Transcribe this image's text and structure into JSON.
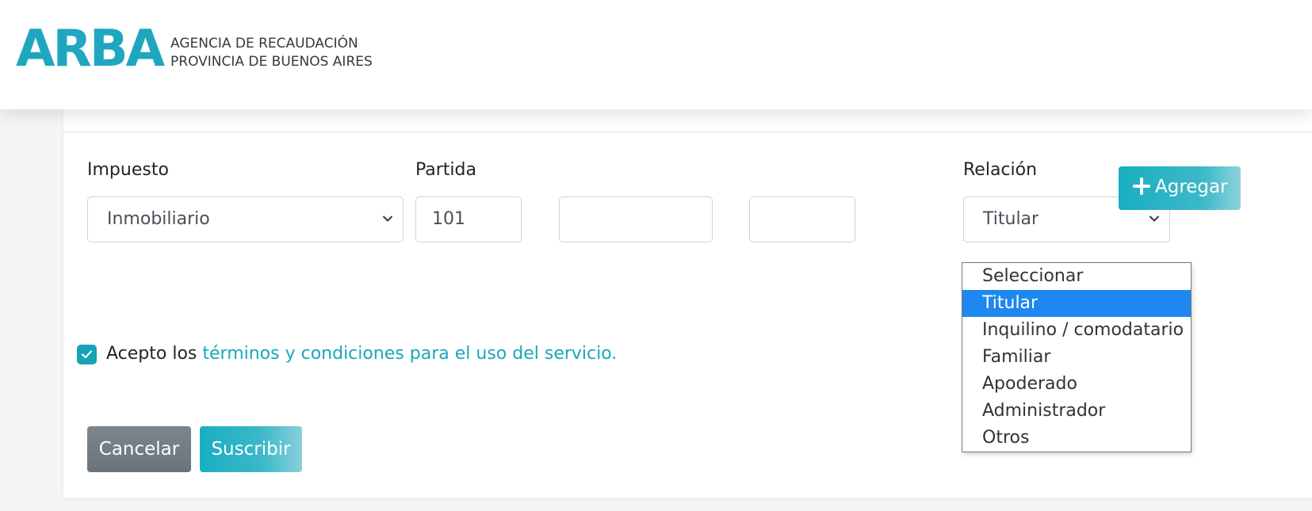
{
  "header": {
    "logo_text": "ARBA",
    "org_line1": "AGENCIA DE RECAUDACIÓN",
    "org_line2": "PROVINCIA DE BUENOS AIRES"
  },
  "form": {
    "impuesto": {
      "label": "Impuesto",
      "value": "Inmobiliario"
    },
    "partida": {
      "label": "Partida",
      "field1": "101",
      "field2": "",
      "field3": ""
    },
    "relacion": {
      "label": "Relación",
      "value": "Titular",
      "options": [
        "Seleccionar",
        "Titular",
        "Inquilino / comodatario",
        "Familiar",
        "Apoderado",
        "Administrador",
        "Otros"
      ],
      "highlighted_index": 1
    },
    "agregar_label": "Agregar",
    "terms": {
      "checked": true,
      "prefix": "Acepto los ",
      "link": "términos y condiciones para el uso del servicio."
    },
    "buttons": {
      "cancelar": "Cancelar",
      "suscribir": "Suscribir"
    }
  },
  "colors": {
    "brand": "#1fa7c0",
    "selection": "#1e87f0",
    "secondary": "#6c757d"
  },
  "icons": {
    "agregar": "plus-icon",
    "select_arrow": "chevron-down-icon",
    "checkbox": "check-icon"
  }
}
